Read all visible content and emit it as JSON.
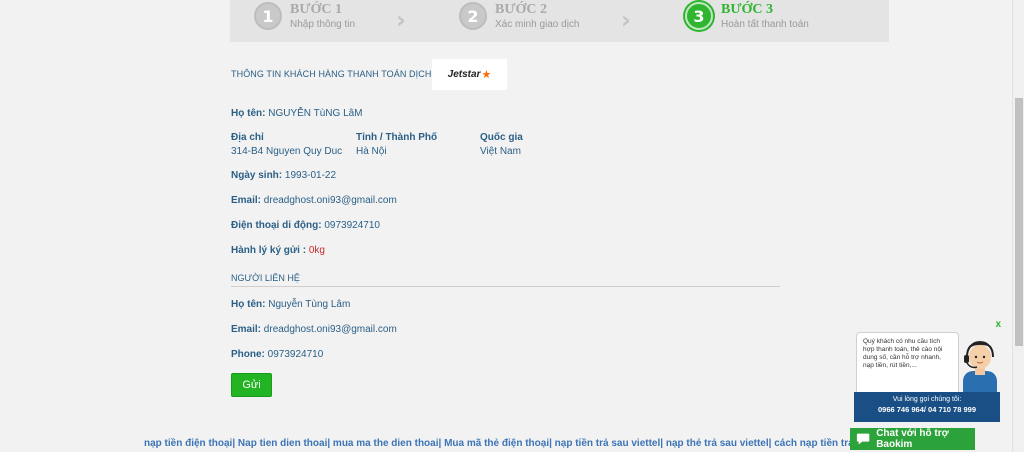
{
  "steps": [
    {
      "num": "1",
      "title": "BƯỚC 1",
      "sub": "Nhập thông tin"
    },
    {
      "num": "2",
      "title": "BƯỚC 2",
      "sub": "Xác minh giao dịch"
    },
    {
      "num": "3",
      "title": "BƯỚC 3",
      "sub": "Hoàn tất thanh toán"
    }
  ],
  "section_title": "THÔNG TIN KHÁCH HÀNG THANH TOÁN DỊCH VỤ",
  "logo_text": "Jetstar",
  "customer": {
    "name_label": "Họ tên:",
    "name_value": "NGUYỄN TùNG LâM",
    "address_label": "Địa chỉ",
    "address_value": "314-B4 Nguyen Quy Duc",
    "city_label": "Tỉnh / Thành Phố",
    "city_value": "Hà Nội",
    "country_label": "Quốc gia",
    "country_value": "Việt Nam",
    "dob_label": "Ngày sinh:",
    "dob_value": "1993-01-22",
    "email_label": "Email:",
    "email_value": "dreadghost.oni93@gmail.com",
    "phone_label": "Điện thoại di động:",
    "phone_value": "0973924710",
    "luggage_label": "Hành lý ký gửi :",
    "luggage_value": "0kg"
  },
  "contact": {
    "title": "NGƯỜI LIÊN HỆ",
    "name_label": "Họ tên:",
    "name_value": "Nguyễn Tùng Lâm",
    "email_label": "Email:",
    "email_value": "dreadghost.oni93@gmail.com",
    "phone_label": "Phone:",
    "phone_value": "0973924710"
  },
  "send_button": "Gửi",
  "bottom_links": "nạp tiền điện thoại| Nap tien dien thoai| mua ma the dien thoai| Mua mã thẻ điện thoại| nạp tiền trả sau viettel| nạp thẻ trả sau viettel| cách nạp tiền trả s",
  "chat_widget": {
    "close": "x",
    "message": "Quý khách có nhu cầu tích hợp thanh toán, thẻ cào nội dung số, cần hỗ trợ nhanh, nạp tiền, rút tiền,...",
    "call_label": "Vui lòng gọi chúng tôi:",
    "phones": "0966 746 964/  04 710 78 999"
  },
  "chat_button": "Chat với hỗ trợ Baokim",
  "colors": {
    "accent_green": "#2fb52f",
    "text_blue": "#2a5f86",
    "link_blue": "#3c74b6",
    "widget_navy": "#1a4f86"
  }
}
